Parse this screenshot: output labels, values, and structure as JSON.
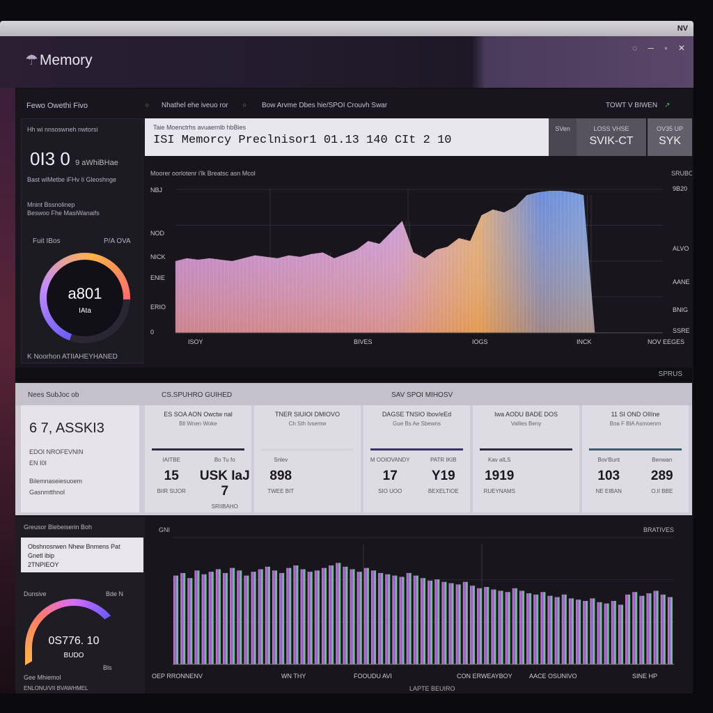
{
  "window": {
    "title_right": "NV"
  },
  "header": {
    "title": "Memory",
    "icons": [
      "search-icon",
      "minimize-icon",
      "maximize-icon",
      "close-icon"
    ],
    "icon_glyphs": "◌ ─ ▫ ✕"
  },
  "top_panel": {
    "left_label": "Fewo Owethi Fivo",
    "tab1": "Nhathel ehe iveuo ror",
    "tab2": "Bow Arvme Dbes hie/SPOI Crouvh Swar",
    "right_label": "TOWT V BIWEN",
    "side": {
      "line1": "Hh wi nnsoswneh nwtorsi",
      "big_value": "0I3 0",
      "big_unit": "9 aWhiBHae",
      "line2": "Bast wlMetbe iFHv Ii Gleoshnge",
      "line3": "Mnint Bssnolinep",
      "line4": "Beswoo Fhe MasiWanaifs",
      "gauge_label": "Fuit IBos",
      "gauge_label_r": "P/A OVA",
      "gauge_value": "a801",
      "gauge_sub": "IAta",
      "footer": "K Noorhon ATIIAHEYHANED"
    },
    "summary": {
      "small": "Taie Moenctrhs avuaernlb hbBies",
      "text": "ISI Memorcy Preclnisor1 01.13 140 CIt 2 10"
    },
    "stats": [
      {
        "label": "SVen",
        "value": ""
      },
      {
        "label": "LOSS VHSE",
        "value": "SVIK-CT"
      },
      {
        "label": "OV35 UP",
        "value": "SYK"
      }
    ],
    "chart_title": "Moorer oorlotenr i'lk Breatsc asn Mcol",
    "chart_right_label": "SRUBO"
  },
  "chart_data": [
    {
      "type": "area",
      "title": "Moorer oorlotenr i'lk Breatsc asn Mcol",
      "y_tick_labels": [
        "NBJ",
        "NOD",
        "NICK",
        "ENIE",
        "ERIO",
        "0"
      ],
      "y_right_labels": [
        "9B20",
        "ALVO",
        "AANE",
        "BNIG",
        "SSRE"
      ],
      "x_tick_labels": [
        "ISOY",
        "BIVES",
        "IOGS",
        "INCK",
        "NOV EEGES"
      ],
      "values": [
        50,
        52,
        51,
        52,
        51,
        50,
        52,
        54,
        53,
        52,
        54,
        53,
        55,
        56,
        52,
        55,
        58,
        64,
        62,
        70,
        78,
        56,
        52,
        58,
        60,
        66,
        64,
        82,
        86,
        84,
        88,
        96,
        98,
        99,
        99,
        98,
        96,
        0,
        0,
        0,
        0,
        0,
        0,
        0
      ],
      "ylim": [
        0,
        100
      ],
      "colors": [
        "#b267e6",
        "#d48ae0",
        "#f0b45a",
        "#4a7fe0",
        "#7fb7f0"
      ]
    },
    {
      "type": "bar",
      "title": "",
      "x_tick_labels": [
        "OEP RRONNENV",
        "WN THY",
        "FOOUDU AVI",
        "CON ERWEAYBOY",
        "AACE OSUNIVO",
        "SINE HP"
      ],
      "right_label": "BRATIVES",
      "right_top": "GNI",
      "bottom_caption": "LAPTE BEUIRO",
      "values": [
        70,
        72,
        68,
        74,
        71,
        73,
        75,
        72,
        76,
        74,
        70,
        73,
        75,
        77,
        74,
        72,
        76,
        78,
        75,
        73,
        74,
        76,
        78,
        80,
        77,
        75,
        73,
        76,
        74,
        72,
        71,
        70,
        69,
        72,
        70,
        68,
        66,
        67,
        65,
        64,
        63,
        65,
        62,
        60,
        61,
        59,
        58,
        57,
        60,
        58,
        56,
        55,
        57,
        54,
        53,
        55,
        52,
        51,
        50,
        52,
        49,
        48,
        50,
        47,
        55,
        57,
        54,
        56,
        58,
        55,
        53
      ],
      "ylim": [
        0,
        100
      ]
    }
  ],
  "mid_strip": {
    "label": "SPRUS"
  },
  "mid_panel": {
    "head_left": "Nees SubJoc ob",
    "head_mid": "CS.SPUHRO GUIHED",
    "head_right": "SAV SPOI MIHOSV",
    "hero": {
      "value": "6 7, ASSKI3",
      "sub1": "EDOI NROFEVNIN",
      "sub2": "EN I0I",
      "sub3": "Bilemnaseiesuoem",
      "sub4": "Gasnmtthnol"
    },
    "metrics": [
      {
        "head": "ES SOA AON Owctw nal",
        "sub": "Bll Wnen Woke",
        "bar_color": "#2c2a40",
        "left": {
          "lab": "IAITBE",
          "val": "15",
          "sub": "BIIR SIJOR"
        },
        "right": {
          "lab": "Bo Tu fo",
          "val": "USK IaJ 7",
          "sub": "SRIIBAHO"
        }
      },
      {
        "head": "TNER SIUIOI DMIOVO",
        "sub": "Ch Sth Ivsemw",
        "bar_color": "#d6d4db",
        "left": {
          "lab": "Snlev",
          "val": "898",
          "sub": "TWEE BIT"
        },
        "right": {
          "lab": "",
          "val": "",
          "sub": ""
        }
      },
      {
        "head": "DAGSE TNSIO Ibov/eEd",
        "sub": "Gue Bs Ae Sbewns",
        "bar_color": "#3b2f70",
        "left": {
          "lab": "M OOIOVANDY",
          "val": "17",
          "sub": "SIO UOO"
        },
        "right": {
          "lab": "PATR IKIB",
          "val": "Y19",
          "sub": "BEXELTIOE"
        }
      },
      {
        "head": "Iwa AODU BADE DOS",
        "sub": "Vallies Beny",
        "bar_color": "#2c2a40",
        "left": {
          "lab": "Kav aILS",
          "val": "1919",
          "sub": "RUEYNAMS"
        },
        "right": {
          "lab": "",
          "val": "",
          "sub": ""
        }
      },
      {
        "head": "11 SI OND OIIIne",
        "sub": "Boa F BlA Asmoenrn",
        "bar_color": "#3b5a70",
        "left": {
          "lab": "Bov'Bunt",
          "val": "103",
          "sub": "NE EIBAN"
        },
        "right": {
          "lab": "Benwan",
          "val": "289",
          "sub": "O.II BBE"
        }
      }
    ]
  },
  "bottom_panel": {
    "head": "Greusor Blebeiserin Boh",
    "inbox_line1": "Obshnosrwen Nhew Bnmens Pat",
    "inbox_line2": "Gnetl ibip",
    "inbox_line3": "2TNPIEOY",
    "cap_left": "Dunsive",
    "cap_right": "Bde N",
    "gauge_value": "0S776. 10",
    "gauge_sub": "BUDO",
    "gauge_label": "Bls",
    "footer1": "Gee Mhiemol",
    "footer2": "ENLONU/VII BVAWHMEL"
  },
  "taskbar": {
    "icons": [
      "start-icon",
      "folder-icon",
      "browser-icon",
      "mail-icon",
      "music-icon",
      "settings-icon",
      "app-icon",
      "app-icon",
      "app-icon"
    ]
  }
}
